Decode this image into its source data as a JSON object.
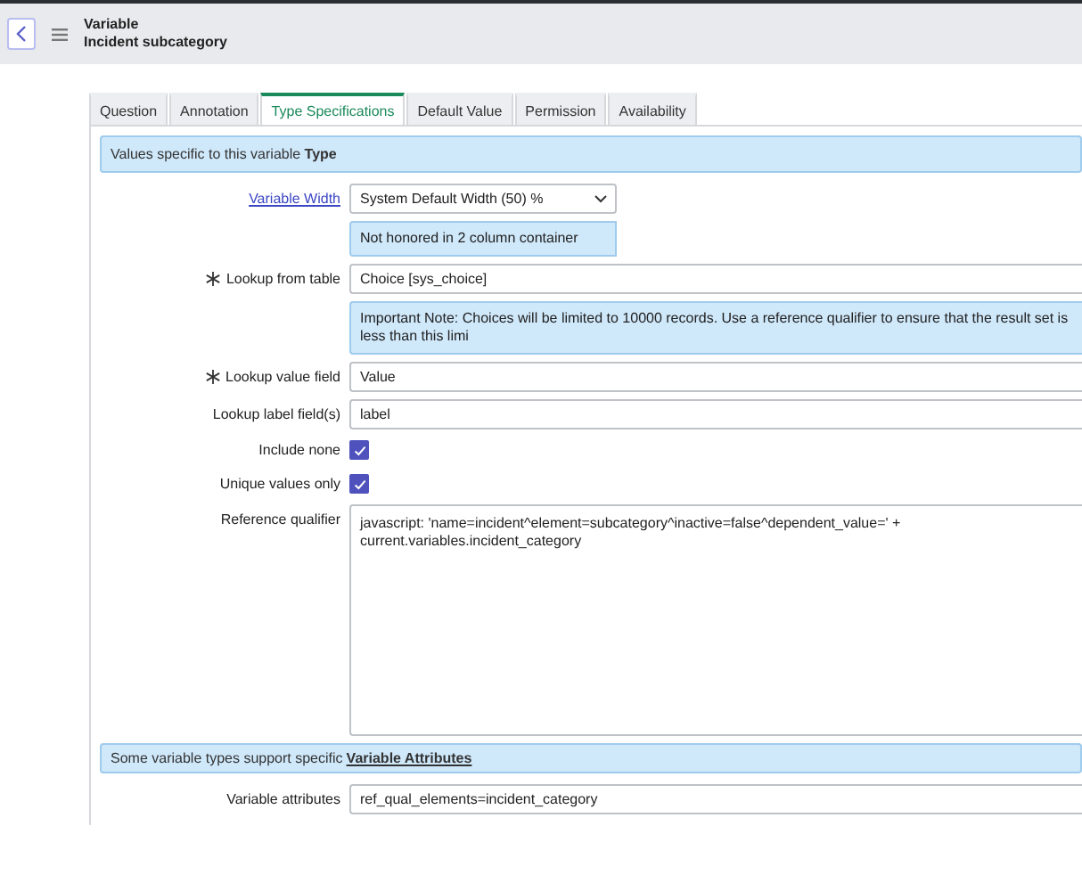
{
  "header": {
    "title": "Variable",
    "subtitle": "Incident subcategory"
  },
  "tabs": [
    {
      "label": "Question",
      "selected": false
    },
    {
      "label": "Annotation",
      "selected": false
    },
    {
      "label": "Type Specifications",
      "selected": true
    },
    {
      "label": "Default Value",
      "selected": false
    },
    {
      "label": "Permission",
      "selected": false
    },
    {
      "label": "Availability",
      "selected": false
    }
  ],
  "intro": {
    "text": "Values specific to this variable **Type**"
  },
  "fields": [
    {
      "kind": "select",
      "label": "Variable Width",
      "label_link": true,
      "required": false,
      "value": "System Default Width (50) %",
      "note": "Not honored in 2 column container"
    },
    {
      "kind": "text",
      "label": "Lookup from table",
      "label_link": false,
      "required": true,
      "value": "Choice [sys_choice]",
      "note": "Important Note: Choices will be limited to 10000 records. Use a reference qualifier to ensure that the result set is less than this limi"
    },
    {
      "kind": "text",
      "label": "Lookup value field",
      "label_link": false,
      "required": true,
      "value": "Value"
    },
    {
      "kind": "text",
      "label": "Lookup label field(s)",
      "label_link": false,
      "required": false,
      "value": "label"
    },
    {
      "kind": "checkbox",
      "label": "Include none",
      "label_link": false,
      "required": false,
      "checked": true
    },
    {
      "kind": "checkbox",
      "label": "Unique values only",
      "label_link": false,
      "required": false,
      "checked": true
    },
    {
      "kind": "textarea",
      "label": "Reference qualifier",
      "label_link": false,
      "required": false,
      "value": "javascript: 'name=incident^element=subcategory^inactive=false^dependent_value=' + current.variables.incident_category"
    }
  ],
  "attributes_note": {
    "text": "Some variable types support specific",
    "link": "Variable Attributes"
  },
  "attributes_field": {
    "label": "Variable attributes",
    "value": "ref_qual_elements=incident_category"
  }
}
